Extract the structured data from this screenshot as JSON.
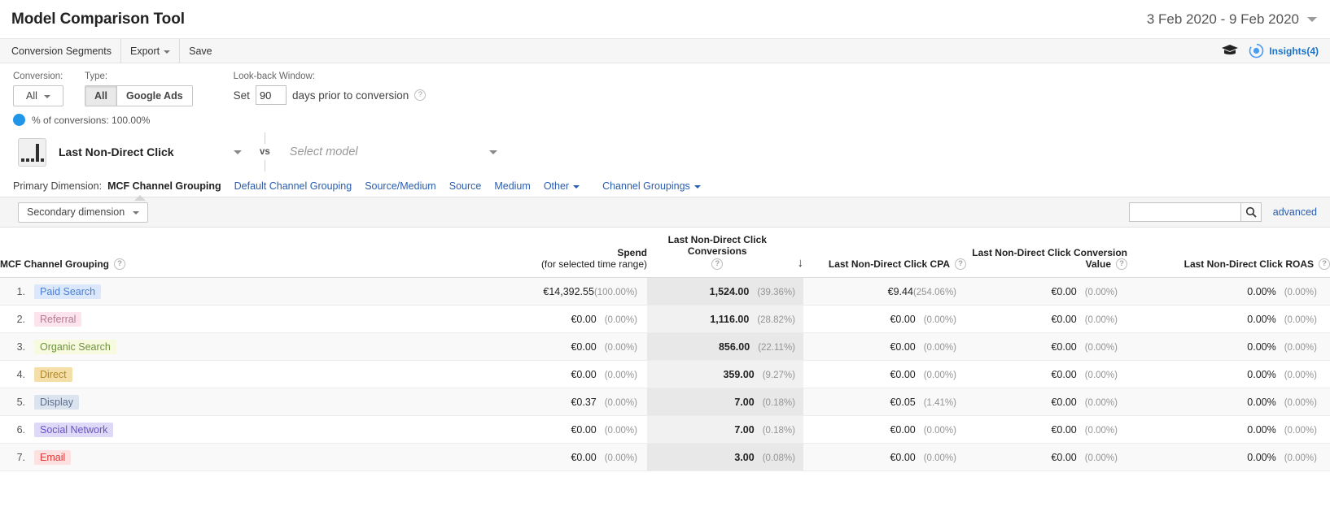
{
  "header": {
    "title": "Model Comparison Tool",
    "date_range": "3 Feb 2020 - 9 Feb 2020"
  },
  "menubar": {
    "items": [
      {
        "label": "Conversion Segments",
        "caret": false
      },
      {
        "label": "Export",
        "caret": true
      },
      {
        "label": "Save",
        "caret": false
      }
    ],
    "insights_label": "Insights(4)",
    "insights_color": "#1a73c8"
  },
  "controls": {
    "conversion_label": "Conversion:",
    "conversion_value": "All",
    "type_label": "Type:",
    "type_options": [
      {
        "label": "All",
        "selected": true
      },
      {
        "label": "Google Ads",
        "selected": false
      }
    ],
    "lookback_label": "Look-back Window:",
    "lookback_prefix": "Set",
    "lookback_value": "90",
    "lookback_suffix": "days prior to conversion",
    "conversions_pct_text": "% of conversions: 100.00%",
    "dot_color": "#2196e8"
  },
  "models": {
    "primary": "Last Non-Direct Click",
    "vs_label": "vs",
    "secondary_placeholder": "Select model"
  },
  "primary_dimension": {
    "label": "Primary Dimension:",
    "active": "MCF Channel Grouping",
    "links": [
      {
        "label": "Default Channel Grouping",
        "caret": false
      },
      {
        "label": "Source/Medium",
        "caret": false
      },
      {
        "label": "Source",
        "caret": false
      },
      {
        "label": "Medium",
        "caret": false
      },
      {
        "label": "Other",
        "caret": true
      },
      {
        "label": "Channel Groupings",
        "caret": true
      }
    ]
  },
  "toolbar": {
    "secondary_dimension": "Secondary dimension",
    "search_value": "",
    "search_placeholder": "",
    "advanced_label": "advanced"
  },
  "table": {
    "columns": [
      {
        "key": "name",
        "line1": "MCF Channel Grouping",
        "line2": "",
        "help": true,
        "sorted": false
      },
      {
        "key": "spend",
        "line1": "Spend",
        "line2": "(for selected time range)",
        "help": false,
        "sorted": false
      },
      {
        "key": "conv",
        "line1": "Last Non-Direct Click Conversions",
        "line2": "",
        "help": true,
        "sorted": true,
        "sort_arrow": "↓"
      },
      {
        "key": "cpa",
        "line1": "Last Non-Direct Click CPA",
        "line2": "",
        "help": true,
        "sorted": false
      },
      {
        "key": "value",
        "line1": "Last Non-Direct Click Conversion",
        "line2": "Value",
        "help": true,
        "sorted": false
      },
      {
        "key": "roas",
        "line1": "Last Non-Direct Click ROAS",
        "line2": "",
        "help": true,
        "sorted": false
      }
    ],
    "rows": [
      {
        "index": "1.",
        "channel": "Paid Search",
        "chip_bg": "#dbe8fb",
        "chip_fg": "#4a7fd4",
        "spend": "€14,392.55",
        "spend_pct": "(100.00%)",
        "spend_tight": true,
        "conversions": "1,524.00",
        "conversions_pct": "(39.36%)",
        "cpa": "€9.44",
        "cpa_pct": "(254.06%)",
        "cpa_tight": true,
        "conv_value": "€0.00",
        "conv_value_pct": "(0.00%)",
        "roas": "0.00%",
        "roas_pct": "(0.00%)"
      },
      {
        "index": "2.",
        "channel": "Referral",
        "chip_bg": "#fbe4ee",
        "chip_fg": "#b5798f",
        "spend": "€0.00",
        "spend_pct": "(0.00%)",
        "spend_tight": false,
        "conversions": "1,116.00",
        "conversions_pct": "(28.82%)",
        "cpa": "€0.00",
        "cpa_pct": "(0.00%)",
        "cpa_tight": false,
        "conv_value": "€0.00",
        "conv_value_pct": "(0.00%)",
        "roas": "0.00%",
        "roas_pct": "(0.00%)"
      },
      {
        "index": "3.",
        "channel": "Organic Search",
        "chip_bg": "#f7fadf",
        "chip_fg": "#6f9141",
        "spend": "€0.00",
        "spend_pct": "(0.00%)",
        "spend_tight": false,
        "conversions": "856.00",
        "conversions_pct": "(22.11%)",
        "cpa": "€0.00",
        "cpa_pct": "(0.00%)",
        "cpa_tight": false,
        "conv_value": "€0.00",
        "conv_value_pct": "(0.00%)",
        "roas": "0.00%",
        "roas_pct": "(0.00%)"
      },
      {
        "index": "4.",
        "channel": "Direct",
        "chip_bg": "#f5dfa8",
        "chip_fg": "#b08a2e",
        "spend": "€0.00",
        "spend_pct": "(0.00%)",
        "spend_tight": false,
        "conversions": "359.00",
        "conversions_pct": "(9.27%)",
        "cpa": "€0.00",
        "cpa_pct": "(0.00%)",
        "cpa_tight": false,
        "conv_value": "€0.00",
        "conv_value_pct": "(0.00%)",
        "roas": "0.00%",
        "roas_pct": "(0.00%)"
      },
      {
        "index": "5.",
        "channel": "Display",
        "chip_bg": "#dbe3ef",
        "chip_fg": "#5c6f8c",
        "spend": "€0.37",
        "spend_pct": "(0.00%)",
        "spend_tight": false,
        "conversions": "7.00",
        "conversions_pct": "(0.18%)",
        "cpa": "€0.05",
        "cpa_pct": "(1.41%)",
        "cpa_tight": false,
        "conv_value": "€0.00",
        "conv_value_pct": "(0.00%)",
        "roas": "0.00%",
        "roas_pct": "(0.00%)"
      },
      {
        "index": "6.",
        "channel": "Social Network",
        "chip_bg": "#ded9f6",
        "chip_fg": "#6a53c4",
        "spend": "€0.00",
        "spend_pct": "(0.00%)",
        "spend_tight": false,
        "conversions": "7.00",
        "conversions_pct": "(0.18%)",
        "cpa": "€0.00",
        "cpa_pct": "(0.00%)",
        "cpa_tight": false,
        "conv_value": "€0.00",
        "conv_value_pct": "(0.00%)",
        "roas": "0.00%",
        "roas_pct": "(0.00%)"
      },
      {
        "index": "7.",
        "channel": "Email",
        "chip_bg": "#fde1e1",
        "chip_fg": "#e03a3a",
        "spend": "€0.00",
        "spend_pct": "(0.00%)",
        "spend_tight": false,
        "conversions": "3.00",
        "conversions_pct": "(0.08%)",
        "cpa": "€0.00",
        "cpa_pct": "(0.00%)",
        "cpa_tight": false,
        "conv_value": "€0.00",
        "conv_value_pct": "(0.00%)",
        "roas": "0.00%",
        "roas_pct": "(0.00%)"
      }
    ]
  }
}
